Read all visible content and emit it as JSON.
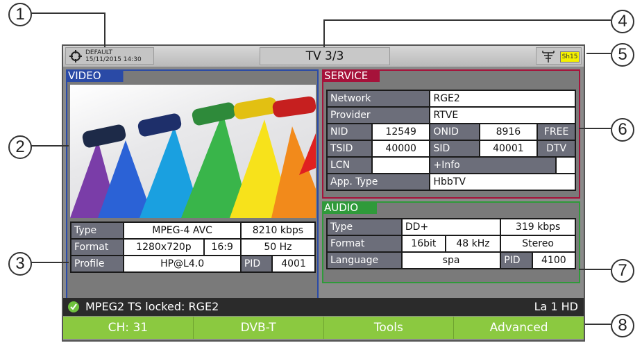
{
  "callouts": [
    "1",
    "2",
    "3",
    "4",
    "5",
    "6",
    "7",
    "8"
  ],
  "topbar": {
    "profile": "DEFAULT",
    "datetime": "15/11/2015 14:30",
    "title": "TV 3/3",
    "signal_badge": "Sh15"
  },
  "video": {
    "header": "VIDEO",
    "type_label": "Type",
    "type": "MPEG-4 AVC",
    "bitrate": "8210 kbps",
    "format_label": "Format",
    "resolution": "1280x720p",
    "aspect": "16:9",
    "rate": "50 Hz",
    "profile_label": "Profile",
    "profile": "HP@L4.0",
    "pid_label": "PID",
    "pid": "4001"
  },
  "service": {
    "header": "SERVICE",
    "network_label": "Network",
    "network": "RGE2",
    "provider_label": "Provider",
    "provider": "RTVE",
    "nid_label": "NID",
    "nid": "12549",
    "onid_label": "ONID",
    "onid": "8916",
    "free": "FREE",
    "tsid_label": "TSID",
    "tsid": "40000",
    "sid_label": "SID",
    "sid": "40001",
    "dtv": "DTV",
    "lcn_label": "LCN",
    "info": "+Info",
    "apptype_label": "App. Type",
    "apptype": "HbbTV"
  },
  "audio": {
    "header": "AUDIO",
    "type_label": "Type",
    "type": "DD+",
    "bitrate": "319 kbps",
    "format_label": "Format",
    "bits": "16bit",
    "freq": "48 kHz",
    "mode": "Stereo",
    "language_label": "Language",
    "language": "spa",
    "pid_label": "PID",
    "pid": "4100"
  },
  "status": {
    "message": "MPEG2 TS locked: RGE2",
    "channel_name": "La 1 HD"
  },
  "softkeys": [
    "CH: 31",
    "DVB-T",
    "Tools",
    "Advanced"
  ],
  "colors": {
    "video": "#2a4aa6",
    "service": "#a6123a",
    "audio": "#2f9a3a",
    "softkey": "#8bc940"
  }
}
